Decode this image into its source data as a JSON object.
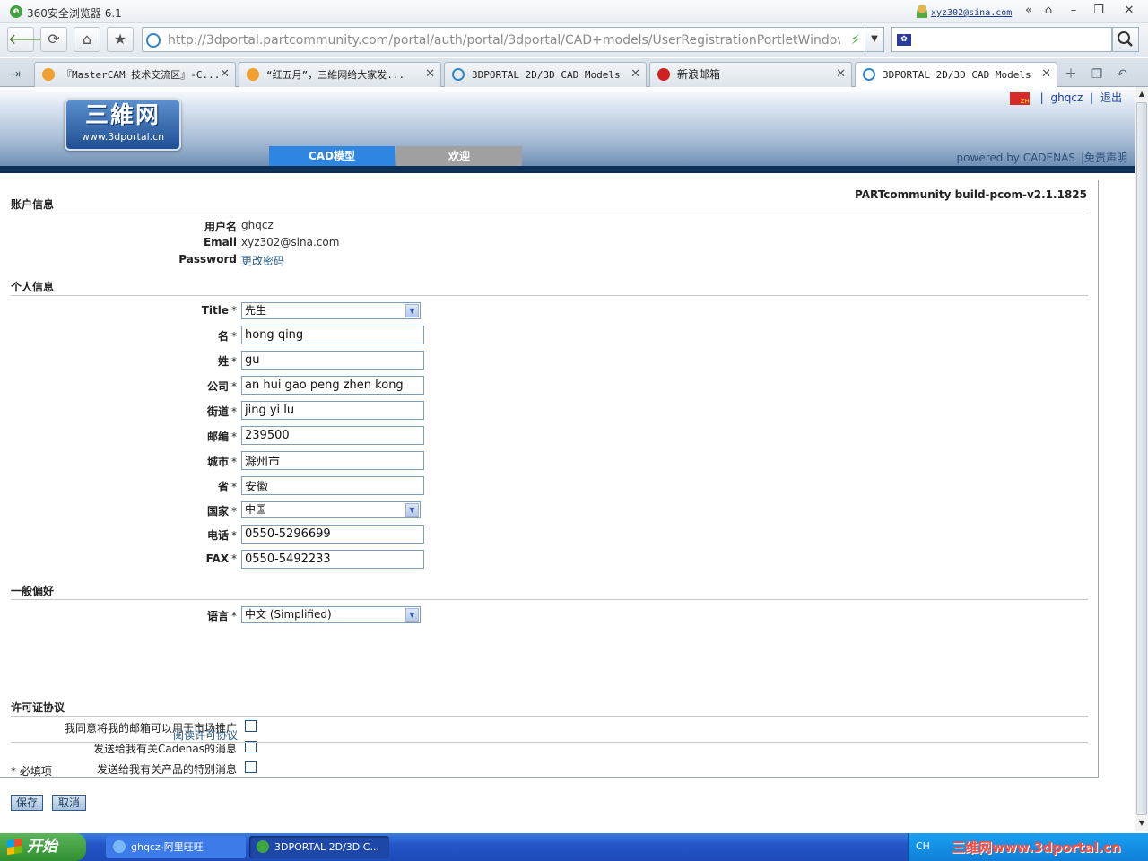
{
  "browser": {
    "app_title": "360安全浏览器 6.1",
    "user_email": "xyz302@sina.com",
    "url": "http://3dportal.partcommunity.com/portal/auth/portal/3dportal/CAD+models/UserRegistrationPortletWindow?action=",
    "tabs": [
      {
        "label": "『MasterCAM 技术交流区』-C...",
        "icon_color": "#f0a030"
      },
      {
        "label": "“红五月”，三維网给大家发...",
        "icon_color": "#f0a030"
      },
      {
        "label": "3DPORTAL 2D/3D CAD Models",
        "icon_color": "#2e87c8"
      },
      {
        "label": "新浪邮箱",
        "icon_color": "#d02020"
      },
      {
        "label": "3DPORTAL 2D/3D CAD Models",
        "icon_color": "#2e87c8"
      }
    ]
  },
  "site": {
    "logo_text": "三維网",
    "logo_url": "www.3dportal.cn",
    "lang_flag": "ZH",
    "user": "ghqcz",
    "logout": "退出",
    "nav": [
      {
        "label": "CAD模型",
        "color": "#2f86e0"
      },
      {
        "label": "欢迎",
        "color": "#a0a0a0"
      }
    ],
    "powered": "powered by CADENAS",
    "disclaimer": "免责声明"
  },
  "form": {
    "build": "PARTcommunity build-pcom-v2.1.1825",
    "account_section": "账户信息",
    "account": {
      "username_label": "用户名",
      "username": "ghqcz",
      "email_label": "Email",
      "email": "xyz302@sina.com",
      "password_label": "Password",
      "password_link": "更改密码"
    },
    "personal_section": "个人信息",
    "personal": {
      "title_label": "Title",
      "title": "先生",
      "first_label": "名",
      "first": "hong qing",
      "last_label": "姓",
      "last": "gu",
      "company_label": "公司",
      "company": "an hui gao peng zhen kong",
      "street_label": "街道",
      "street": "jing yi lu",
      "zip_label": "邮编",
      "zip": "239500",
      "city_label": "城市",
      "city": "滁州市",
      "province_label": "省",
      "province": "安徽",
      "country_label": "国家",
      "country": "中国",
      "phone_label": "电话",
      "phone": "0550-5296699",
      "fax_label": "FAX",
      "fax": "0550-5492233"
    },
    "required_mark": "*",
    "prefs_section": "一般偏好",
    "prefs": {
      "language_label": "语言",
      "language": "中文 (Simplified)",
      "opt1": "我同意将我的邮箱可以用于市场推广",
      "opt2": "发送给我有关Cadenas的消息",
      "opt3": "发送给我有关产品的特别消息"
    },
    "license_section": "许可证协议",
    "license_link": "阅读许可协议",
    "required_note": "* 必填项",
    "save": "保存",
    "cancel": "取消"
  },
  "taskbar": {
    "start": "开始",
    "tasks": [
      "ghqcz-阿里旺旺",
      "3DPORTAL 2D/3D C..."
    ],
    "lang": "CH",
    "watermark": "三维网www.3dportal.cn"
  }
}
